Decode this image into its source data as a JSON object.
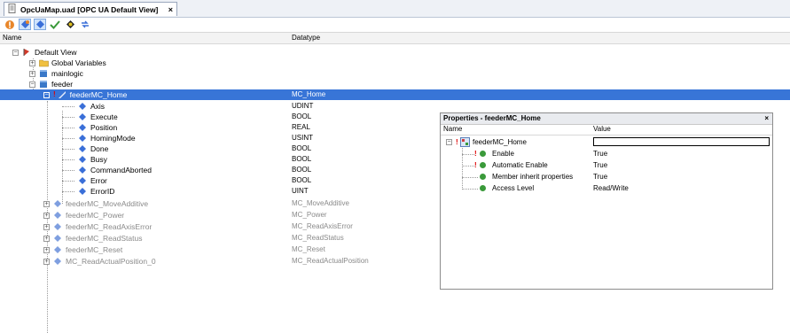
{
  "tab": {
    "title": "OpcUaMap.uad [OPC UA Default View]",
    "close": "×"
  },
  "toolbar": {
    "buttons": [
      "warning-icon",
      "add-icon",
      "remove-icon",
      "check-icon",
      "arrow-icon",
      "sync-icon"
    ]
  },
  "columns": {
    "name": "Name",
    "datatype": "Datatype"
  },
  "tree": {
    "root": "Default View",
    "global_variables": "Global Variables",
    "mainlogic": "mainlogic",
    "feeder": "feeder",
    "selected": {
      "name": "feederMC_Home",
      "type": "MC_Home"
    },
    "children": [
      {
        "name": "Axis",
        "type": "UDINT"
      },
      {
        "name": "Execute",
        "type": "BOOL"
      },
      {
        "name": "Position",
        "type": "REAL"
      },
      {
        "name": "HomingMode",
        "type": "USINT"
      },
      {
        "name": "Done",
        "type": "BOOL"
      },
      {
        "name": "Busy",
        "type": "BOOL"
      },
      {
        "name": "CommandAborted",
        "type": "BOOL"
      },
      {
        "name": "Error",
        "type": "BOOL"
      },
      {
        "name": "ErrorID",
        "type": "UINT"
      }
    ],
    "siblings": [
      {
        "name": "feederMC_MoveAdditive",
        "type": "MC_MoveAdditive"
      },
      {
        "name": "feederMC_Power",
        "type": "MC_Power"
      },
      {
        "name": "feederMC_ReadAxisError",
        "type": "MC_ReadAxisError"
      },
      {
        "name": "feederMC_ReadStatus",
        "type": "MC_ReadStatus"
      },
      {
        "name": "feederMC_Reset",
        "type": "MC_Reset"
      },
      {
        "name": "MC_ReadActualPosition_0",
        "type": "MC_ReadActualPosition"
      }
    ]
  },
  "properties": {
    "title": "Properties - feederMC_Home",
    "close": "×",
    "col_name": "Name",
    "col_value": "Value",
    "root": "feederMC_Home",
    "rows": [
      {
        "name": "Enable",
        "value": "True"
      },
      {
        "name": "Automatic Enable",
        "value": "True"
      },
      {
        "name": "Member inherit properties",
        "value": "True"
      },
      {
        "name": "Access Level",
        "value": "Read/Write"
      }
    ]
  },
  "colors": {
    "selection": "#3875d7",
    "folder": "#f0c040",
    "db": "#3a78c8",
    "variable": "#3a6fd8",
    "ok": "#3a9a3a"
  }
}
